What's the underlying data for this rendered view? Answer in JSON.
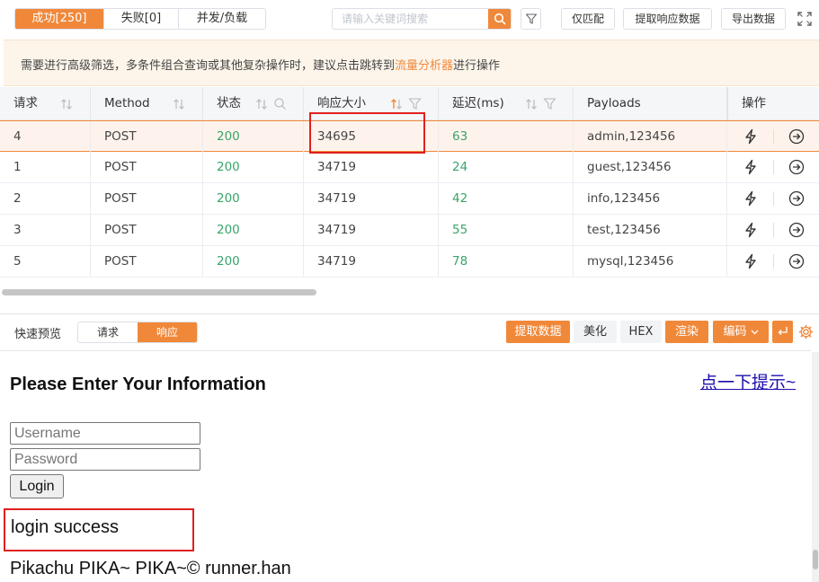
{
  "tabs": [
    {
      "label": "成功[250]",
      "active": true
    },
    {
      "label": "失败[0]",
      "active": false
    },
    {
      "label": "并发/负载",
      "active": false
    }
  ],
  "search": {
    "placeholder": "请输入关键词搜索"
  },
  "toolbar": {
    "match_only": "仅匹配",
    "extract_response": "提取响应数据",
    "export": "导出数据"
  },
  "notice": {
    "before": "需要进行高级筛选，多条件组合查询或其他复杂操作时，建议点击跳转到",
    "link": "流量分析器",
    "after": "进行操作"
  },
  "columns": [
    "请求",
    "Method",
    "状态",
    "响应大小",
    "延迟(ms)",
    "Payloads",
    "操作"
  ],
  "rows": [
    {
      "req": "4",
      "method": "POST",
      "status": "200",
      "size": "34695",
      "latency": "63",
      "payload": "admin,123456",
      "selected": true
    },
    {
      "req": "1",
      "method": "POST",
      "status": "200",
      "size": "34719",
      "latency": "24",
      "payload": "guest,123456",
      "selected": false
    },
    {
      "req": "2",
      "method": "POST",
      "status": "200",
      "size": "34719",
      "latency": "42",
      "payload": "info,123456",
      "selected": false
    },
    {
      "req": "3",
      "method": "POST",
      "status": "200",
      "size": "34719",
      "latency": "55",
      "payload": "test,123456",
      "selected": false
    },
    {
      "req": "5",
      "method": "POST",
      "status": "200",
      "size": "34719",
      "latency": "78",
      "payload": "mysql,123456",
      "selected": false
    }
  ],
  "preview": {
    "label": "快速预览",
    "seg_request": "请求",
    "seg_response": "响应",
    "btn_extract": "提取数据",
    "btn_beautify": "美化",
    "btn_hex": "HEX",
    "btn_render": "渲染",
    "btn_encoding": "编码"
  },
  "rendered": {
    "heading": "Please Enter Your Information",
    "hint_link": "点一下提示~",
    "username_placeholder": "Username",
    "password_placeholder": "Password",
    "login_button": "Login",
    "result": "login success",
    "footer": "Pikachu PIKA~ PIKA~© runner.han"
  },
  "colors": {
    "accent": "#f0883a",
    "status_green": "#3aa36a",
    "annotation_red": "#e02020"
  },
  "icons": [
    "search-icon",
    "filter-icon",
    "expand-icon",
    "sort-icon",
    "bolt-icon",
    "arrow-circle-right-icon",
    "wrap-icon",
    "gear-icon",
    "chevron-down-icon"
  ]
}
